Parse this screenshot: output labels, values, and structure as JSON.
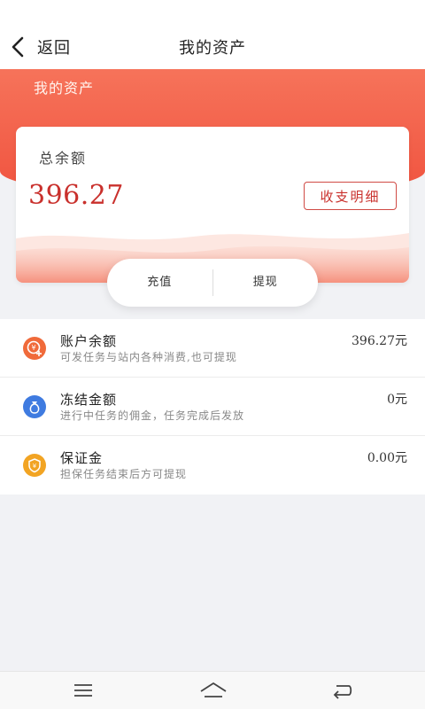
{
  "header": {
    "back_label": "返回",
    "title": "我的资产"
  },
  "hero": {
    "title": "我的资产"
  },
  "balance_card": {
    "label": "总余额",
    "amount": "396.27",
    "detail_button": "收支明细"
  },
  "actions": {
    "recharge": "充值",
    "withdraw": "提现"
  },
  "accounts": [
    {
      "title": "账户余额",
      "desc": "可发任务与站内各种消费,也可提现",
      "value": "396.27元",
      "icon": "coin-plus-icon",
      "color": "#f06a3a"
    },
    {
      "title": "冻结金额",
      "desc": "进行中任务的佣金，任务完成后发放",
      "value": "0元",
      "icon": "money-bag-icon",
      "color": "#3f7be0"
    },
    {
      "title": "保证金",
      "desc": "担保任务结束后方可提现",
      "value": "0.00元",
      "icon": "shield-icon",
      "color": "#f2a423"
    }
  ],
  "colors": {
    "accent": "#f0533f",
    "amount": "#c9302c"
  }
}
